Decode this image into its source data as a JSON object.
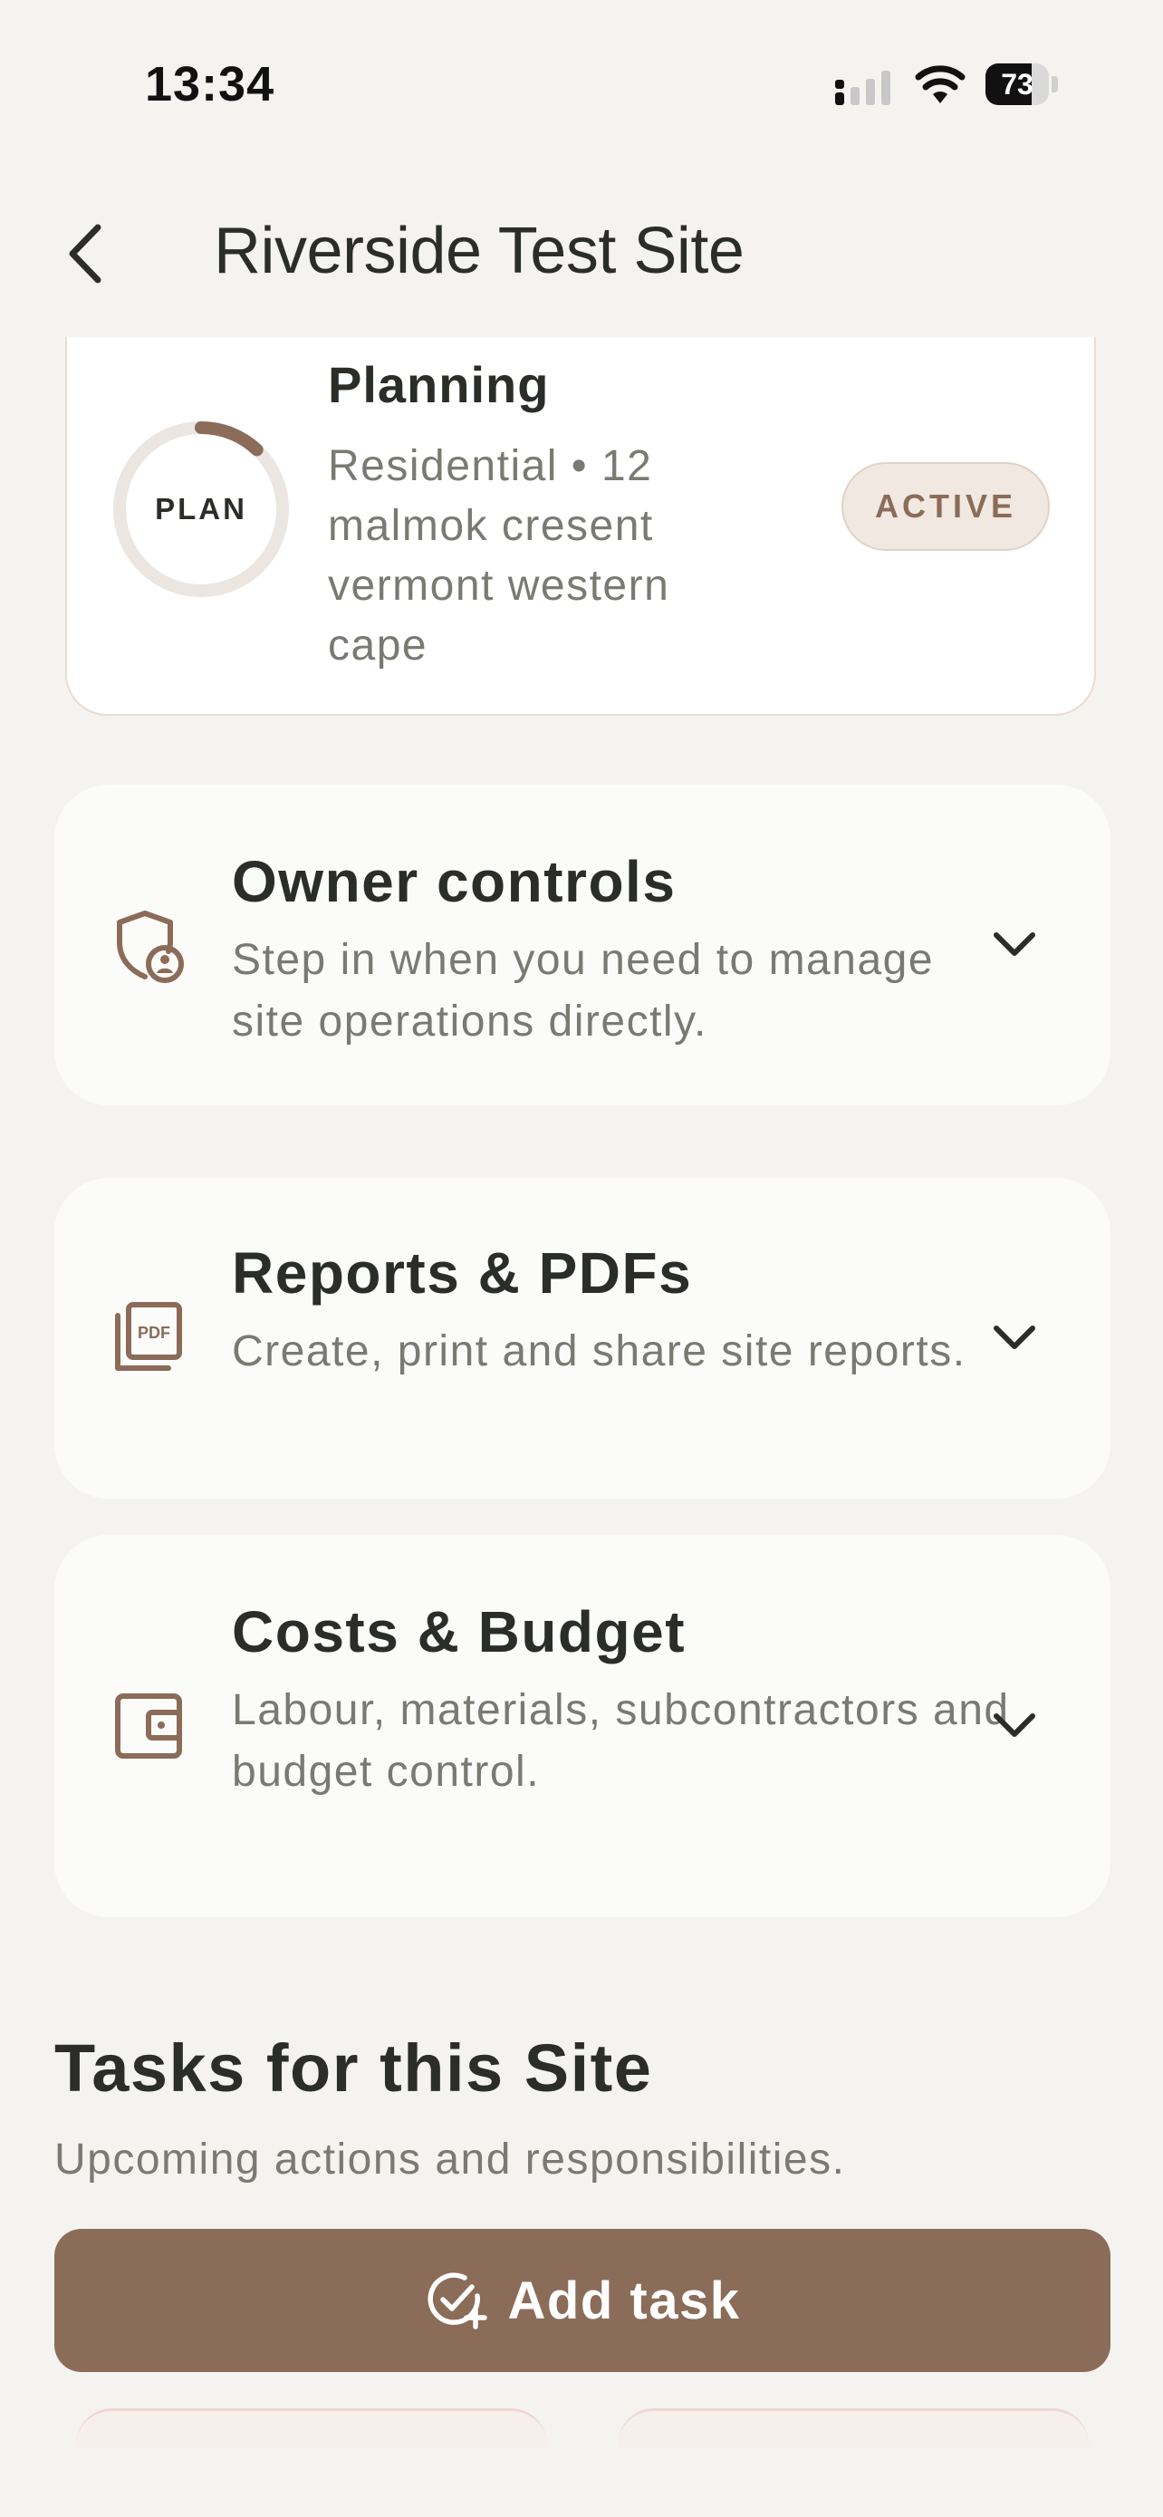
{
  "status_bar": {
    "time": "13:34",
    "battery": "73",
    "battery_level": 0.73
  },
  "header": {
    "title": "Riverside Test Site"
  },
  "plan_card": {
    "ring_label": "PLAN",
    "ring_progress": 0.12,
    "title": "Planning",
    "meta": "Residential • 12 malmok cresent vermont western cape",
    "badge": "ACTIVE"
  },
  "sections": [
    {
      "title": "Owner controls",
      "description": "Step in when you need to manage site operations directly."
    },
    {
      "title": "Reports & PDFs",
      "description": "Create, print and share site reports."
    },
    {
      "title": "Costs & Budget",
      "description": "Labour, materials, subcontractors and budget control."
    }
  ],
  "tasks": {
    "title": "Tasks for this Site",
    "subtitle": "Upcoming actions and responsibilities.",
    "add_label": "Add task"
  },
  "colors": {
    "background": "#f4f3ef",
    "accent": "#8b6c59",
    "text": "#2b2e28",
    "muted": "#7a7a74"
  }
}
